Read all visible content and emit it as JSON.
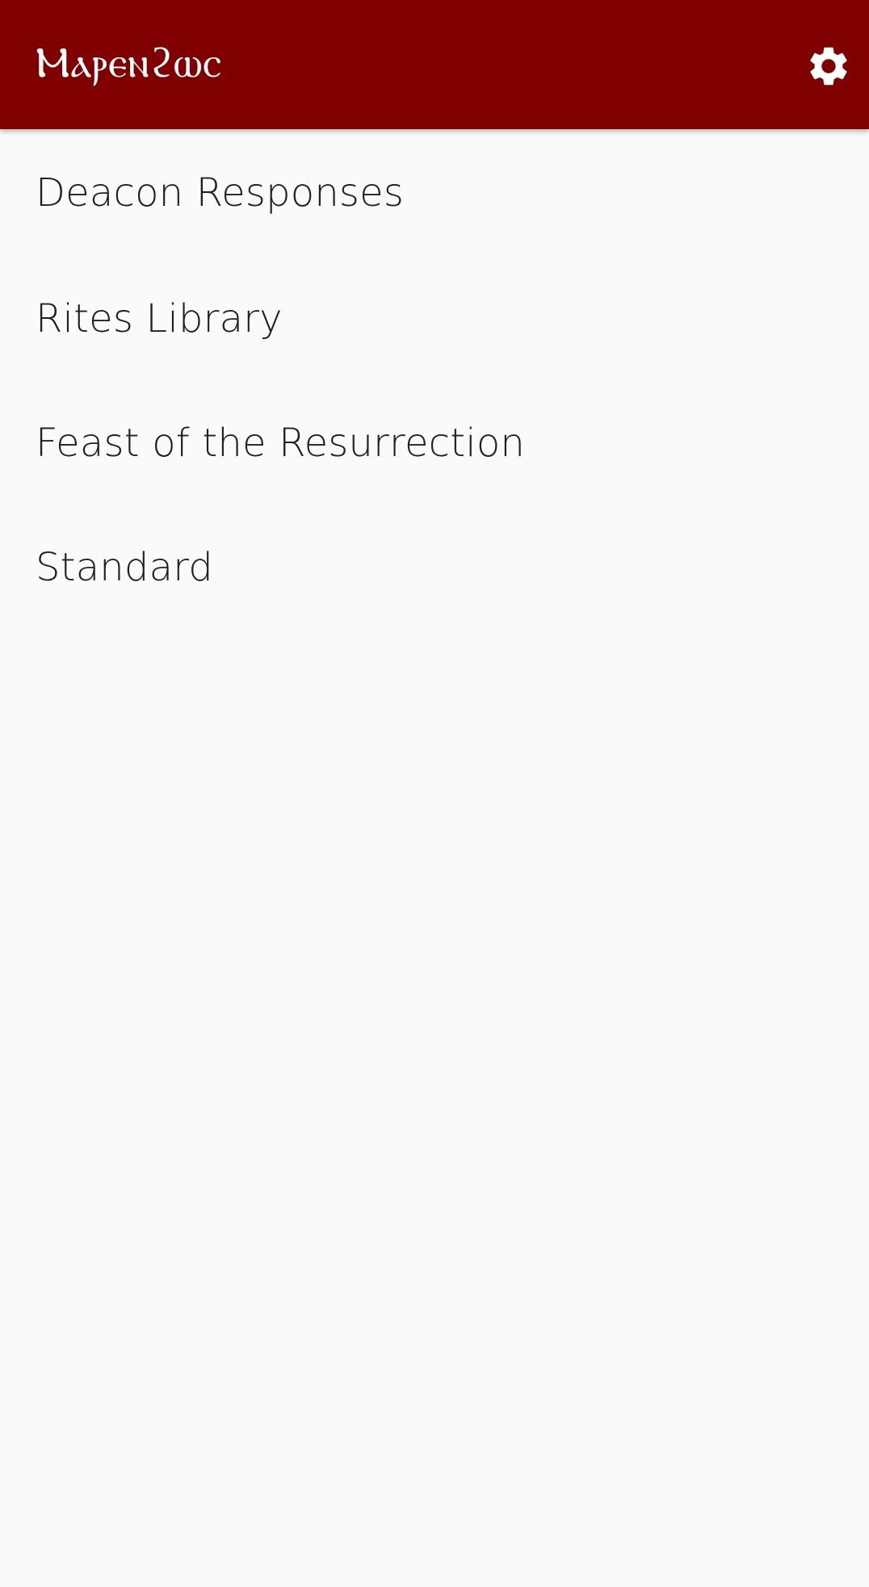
{
  "app_bar": {
    "title": "Ⲙⲁⲣⲉⲛϩⲱⲥ",
    "settings_icon": "gear-icon",
    "background_color": "#800000",
    "title_color": "#ffffff"
  },
  "menu": {
    "items": [
      {
        "label": "Deacon Responses"
      },
      {
        "label": "Rites Library"
      },
      {
        "label": "Feast of the Resurrection"
      },
      {
        "label": "Standard"
      }
    ]
  },
  "colors": {
    "background": "#fafafa",
    "text": "#202020"
  }
}
